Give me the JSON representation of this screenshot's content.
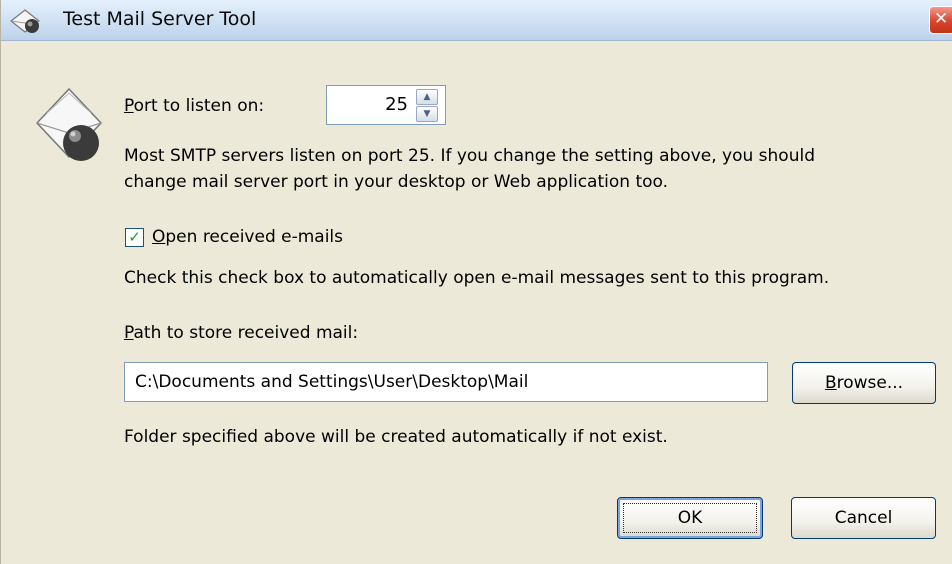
{
  "window": {
    "title": "Test Mail Server Tool",
    "close_symbol": "✕"
  },
  "icons": {
    "title_icon": "mail-server-icon",
    "main_icon": "envelope-globe-icon",
    "close_icon": "close-icon"
  },
  "port": {
    "label_prefix": "",
    "label_ul": "P",
    "label_rest": "ort to listen on:",
    "value": "25"
  },
  "port_help": {
    "line1": "Most SMTP servers listen on port 25. If you change the setting above, you should",
    "line2": "change mail server port in your desktop or Web application too."
  },
  "open_mails": {
    "checked": true,
    "label_ul": "O",
    "label_rest": "pen received e-mails",
    "help": "Check this check box to automatically open e-mail messages sent to this program."
  },
  "path": {
    "label_ul": "P",
    "label_rest": "ath to store received mail:",
    "value": "C:\\Documents and Settings\\User\\Desktop\\Mail",
    "browse_ul": "B",
    "browse_rest": "rowse...",
    "help": "Folder specified above will be created automatically if not exist."
  },
  "buttons": {
    "ok": "OK",
    "cancel": "Cancel"
  }
}
